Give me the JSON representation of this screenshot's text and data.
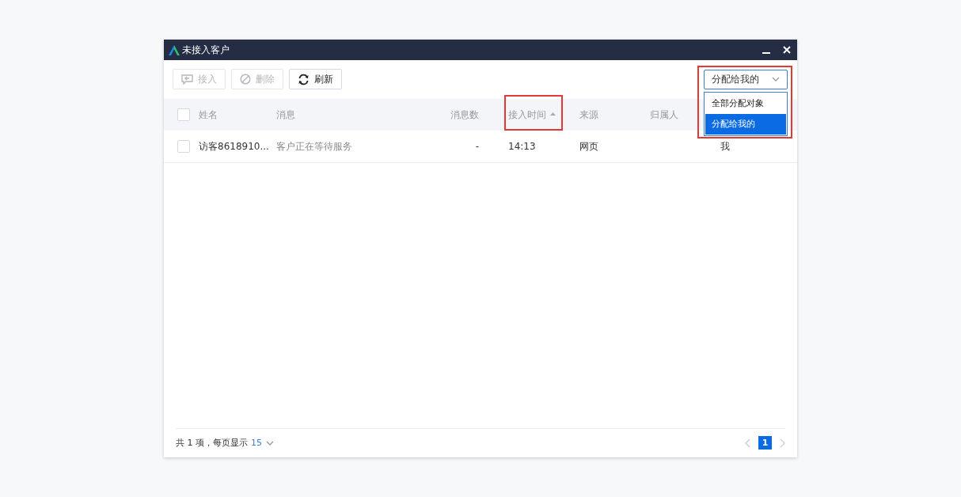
{
  "window": {
    "title": "未接入客户"
  },
  "toolbar": [
    {
      "label": "接入",
      "kind": "accept",
      "disabled": true
    },
    {
      "label": "删除",
      "kind": "delete",
      "disabled": true
    },
    {
      "label": "刷新",
      "kind": "refresh",
      "disabled": false
    }
  ],
  "filter": {
    "value": "分配给我的",
    "highlighted": true,
    "expanded": true,
    "options": [
      {
        "label": "全部分配对象",
        "selected": false
      },
      {
        "label": "分配给我的",
        "selected": true
      }
    ]
  },
  "table": {
    "all_checked": false,
    "columns": [
      {
        "label": "姓名",
        "sorted": false,
        "highlighted": false
      },
      {
        "label": "消息",
        "sorted": false,
        "highlighted": false
      },
      {
        "label": "消息数",
        "sorted": false,
        "highlighted": false
      },
      {
        "label": "接入时间",
        "sorted": true,
        "highlighted": true
      },
      {
        "label": "来源",
        "sorted": false,
        "highlighted": false
      },
      {
        "label": "归属人",
        "sorted": false,
        "highlighted": false
      }
    ],
    "rows": [
      {
        "checked": false,
        "name": "访客8618910...",
        "message": "客户正在等待服务",
        "count": "-",
        "time": "14:13",
        "source": "网页",
        "column_7": "我"
      }
    ]
  },
  "footer": {
    "summary": "共 1 项，每页显示",
    "page_size": "15",
    "pages": [
      {
        "label": "1",
        "selected": true
      }
    ]
  }
}
